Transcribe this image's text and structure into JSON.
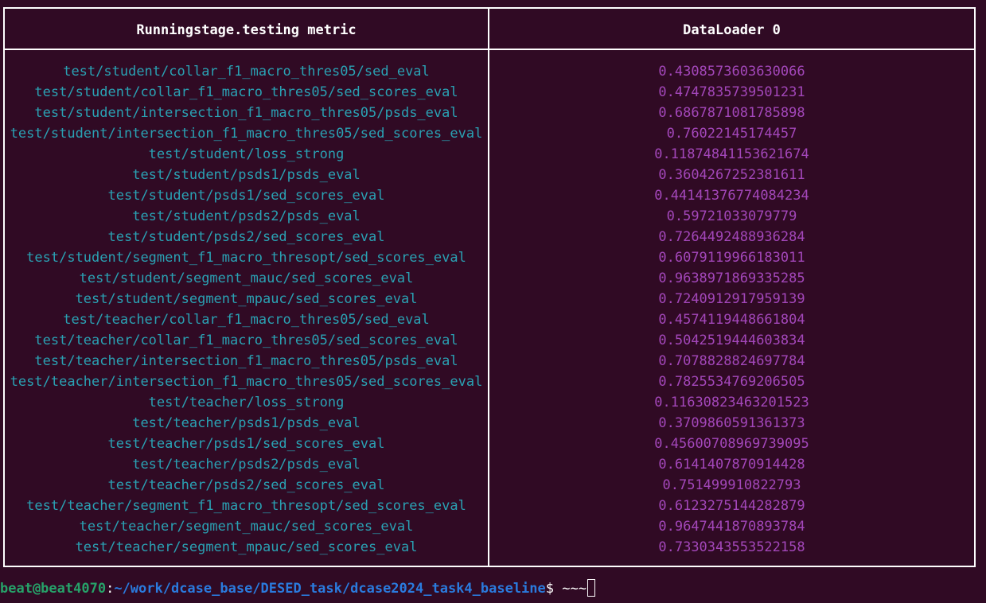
{
  "table": {
    "header": {
      "col1": "Runningstage.testing metric",
      "col2": "DataLoader 0"
    },
    "rows": [
      {
        "metric": "test/student/collar_f1_macro_thres05/sed_eval",
        "value": "0.4308573603630066"
      },
      {
        "metric": "test/student/collar_f1_macro_thres05/sed_scores_eval",
        "value": "0.4747835739501231"
      },
      {
        "metric": "test/student/intersection_f1_macro_thres05/psds_eval",
        "value": "0.6867871081785898"
      },
      {
        "metric": "test/student/intersection_f1_macro_thres05/sed_scores_eval",
        "value": "0.76022145174457"
      },
      {
        "metric": "test/student/loss_strong",
        "value": "0.11874841153621674"
      },
      {
        "metric": "test/student/psds1/psds_eval",
        "value": "0.3604267252381611"
      },
      {
        "metric": "test/student/psds1/sed_scores_eval",
        "value": "0.44141376774084234"
      },
      {
        "metric": "test/student/psds2/psds_eval",
        "value": "0.59721033079779"
      },
      {
        "metric": "test/student/psds2/sed_scores_eval",
        "value": "0.7264492488936284"
      },
      {
        "metric": "test/student/segment_f1_macro_thresopt/sed_scores_eval",
        "value": "0.6079119966183011"
      },
      {
        "metric": "test/student/segment_mauc/sed_scores_eval",
        "value": "0.9638971869335285"
      },
      {
        "metric": "test/student/segment_mpauc/sed_scores_eval",
        "value": "0.7240912917959139"
      },
      {
        "metric": "test/teacher/collar_f1_macro_thres05/sed_eval",
        "value": "0.4574119448661804"
      },
      {
        "metric": "test/teacher/collar_f1_macro_thres05/sed_scores_eval",
        "value": "0.5042519444603834"
      },
      {
        "metric": "test/teacher/intersection_f1_macro_thres05/psds_eval",
        "value": "0.7078828824697784"
      },
      {
        "metric": "test/teacher/intersection_f1_macro_thres05/sed_scores_eval",
        "value": "0.7825534769206505"
      },
      {
        "metric": "test/teacher/loss_strong",
        "value": "0.11630823463201523"
      },
      {
        "metric": "test/teacher/psds1/psds_eval",
        "value": "0.3709860591361373"
      },
      {
        "metric": "test/teacher/psds1/sed_scores_eval",
        "value": "0.45600708969739095"
      },
      {
        "metric": "test/teacher/psds2/psds_eval",
        "value": "0.6141407870914428"
      },
      {
        "metric": "test/teacher/psds2/sed_scores_eval",
        "value": "0.751499910822793"
      },
      {
        "metric": "test/teacher/segment_f1_macro_thresopt/sed_scores_eval",
        "value": "0.6123275144282879"
      },
      {
        "metric": "test/teacher/segment_mauc/sed_scores_eval",
        "value": "0.9647441870893784"
      },
      {
        "metric": "test/teacher/segment_mpauc/sed_scores_eval",
        "value": "0.7330343553522158"
      }
    ]
  },
  "prompt": {
    "user_host": "beat@beat4070",
    "separator": ":",
    "path": "~/work/dcase_base/DESED_task/dcase2024_task4_baseline",
    "symbol": "$ ",
    "input": "~~~"
  },
  "colors": {
    "background": "#300a24",
    "metric_text": "#2aa1b3",
    "value_text": "#a347ba",
    "user_host": "#26a269",
    "path": "#2a7bde"
  }
}
